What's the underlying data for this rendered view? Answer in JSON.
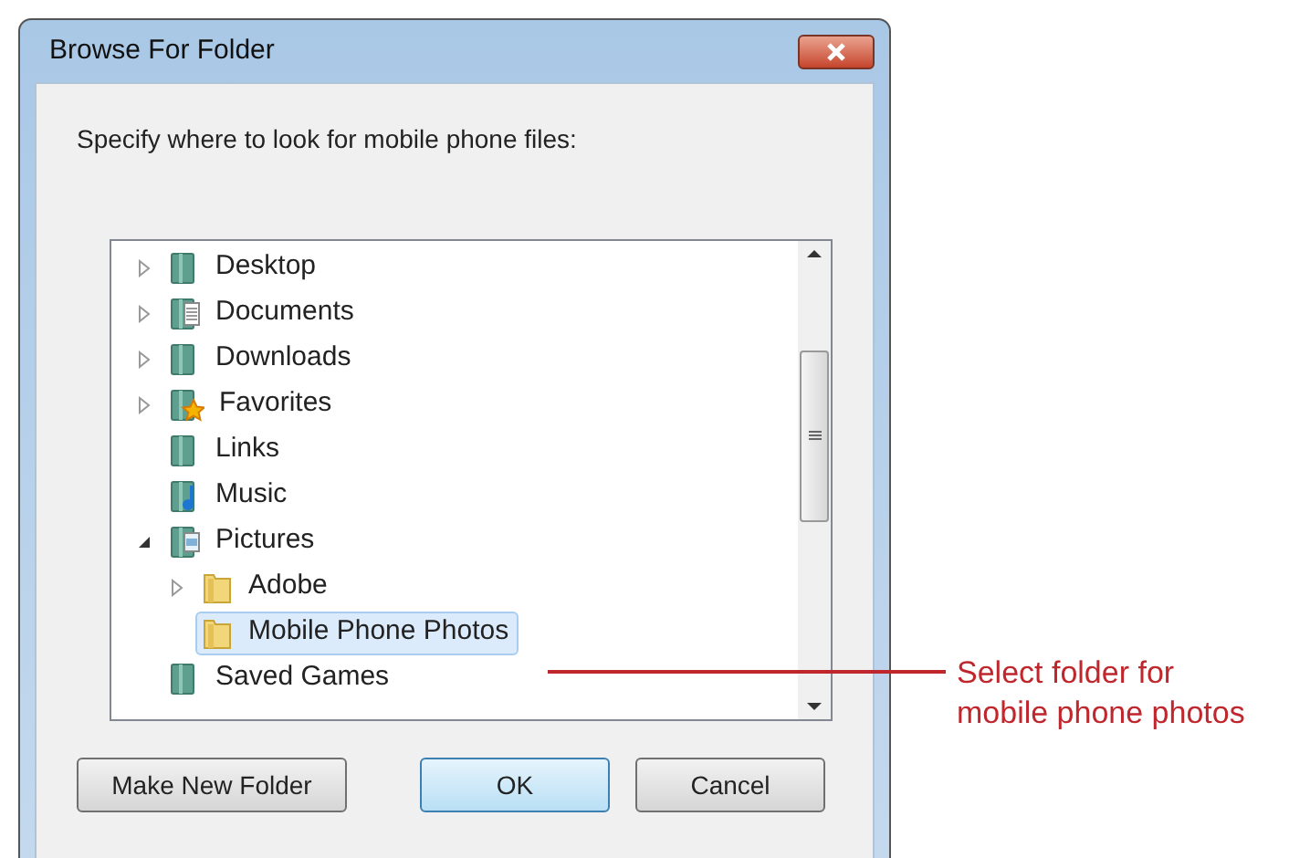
{
  "window": {
    "title": "Browse For Folder"
  },
  "prompt": "Specify where to look for mobile phone files:",
  "tree": [
    {
      "label": "Desktop",
      "kind": "library",
      "expanded": false,
      "selected": false
    },
    {
      "label": "Documents",
      "kind": "documents",
      "expanded": false,
      "selected": false
    },
    {
      "label": "Downloads",
      "kind": "library",
      "expanded": false,
      "selected": false
    },
    {
      "label": "Favorites",
      "kind": "favorites",
      "expanded": false,
      "selected": false
    },
    {
      "label": "Links",
      "kind": "library",
      "selected": false
    },
    {
      "label": "Music",
      "kind": "music",
      "selected": false
    },
    {
      "label": "Pictures",
      "kind": "pictures",
      "expanded": true,
      "selected": false,
      "children": [
        {
          "label": "Adobe",
          "kind": "folder",
          "expanded": false,
          "selected": false
        },
        {
          "label": "Mobile Phone Photos",
          "kind": "folder",
          "selected": true
        }
      ]
    },
    {
      "label": "Saved Games",
      "kind": "library",
      "selected": false
    }
  ],
  "buttons": [
    {
      "label": "Make New Folder",
      "default": false
    },
    {
      "label": "OK",
      "default": true
    },
    {
      "label": "Cancel",
      "default": false
    }
  ],
  "callout": "Select folder for mobile phone photos"
}
